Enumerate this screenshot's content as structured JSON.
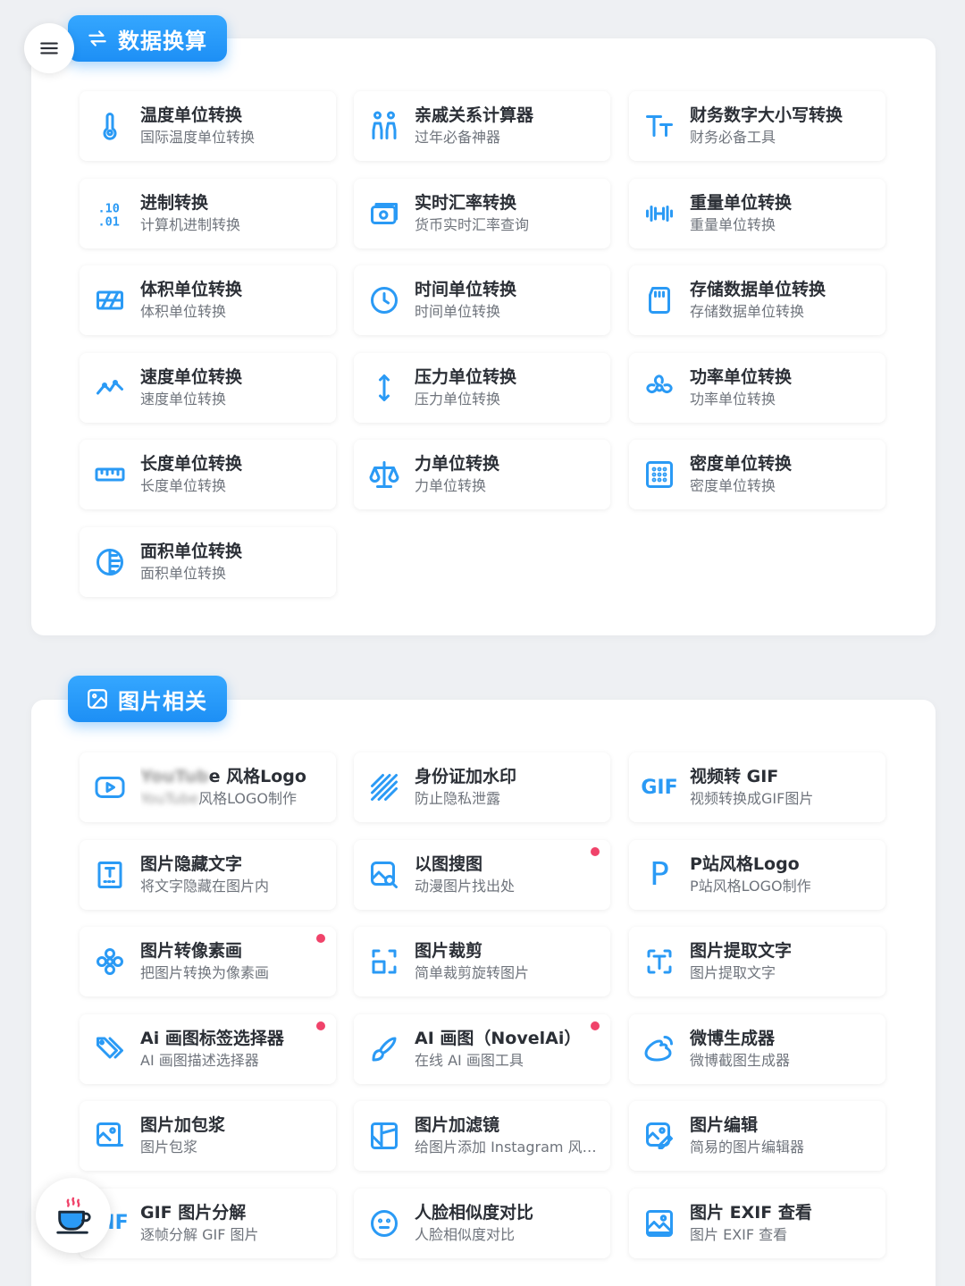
{
  "menu_button": {
    "icon": "menu-icon"
  },
  "coffee_button": {
    "icon": "coffee-cup-icon"
  },
  "sections": [
    {
      "title": "数据换算",
      "icon": "swap-arrows-icon",
      "items": [
        {
          "title": "温度单位转换",
          "subtitle": "国际温度单位转换",
          "icon": "thermometer-icon"
        },
        {
          "title": "亲戚关系计算器",
          "subtitle": "过年必备神器",
          "icon": "family-icon"
        },
        {
          "title": "财务数字大小写转换",
          "subtitle": "财务必备工具",
          "icon": "text-size-icon"
        },
        {
          "title": "进制转换",
          "subtitle": "计算机进制转换",
          "icon": "binary-icon"
        },
        {
          "title": "实时汇率转换",
          "subtitle": "货币实时汇率查询",
          "icon": "currency-icon"
        },
        {
          "title": "重量单位转换",
          "subtitle": "重量单位转换",
          "icon": "dumbbell-icon"
        },
        {
          "title": "体积单位转换",
          "subtitle": "体积单位转换",
          "icon": "volume-icon"
        },
        {
          "title": "时间单位转换",
          "subtitle": "时间单位转换",
          "icon": "clock-icon"
        },
        {
          "title": "存储数据单位转换",
          "subtitle": "存储数据单位转换",
          "icon": "sd-card-icon"
        },
        {
          "title": "速度单位转换",
          "subtitle": "速度单位转换",
          "icon": "line-chart-icon"
        },
        {
          "title": "压力单位转换",
          "subtitle": "压力单位转换",
          "icon": "up-down-arrow-icon"
        },
        {
          "title": "功率单位转换",
          "subtitle": "功率单位转换",
          "icon": "fan-icon"
        },
        {
          "title": "长度单位转换",
          "subtitle": "长度单位转换",
          "icon": "ruler-icon"
        },
        {
          "title": "力单位转换",
          "subtitle": "力单位转换",
          "icon": "scale-icon"
        },
        {
          "title": "密度单位转换",
          "subtitle": "密度单位转换",
          "icon": "grid-dots-icon"
        },
        {
          "title": "面积单位转换",
          "subtitle": "面积单位转换",
          "icon": "area-circle-icon"
        }
      ]
    },
    {
      "title": "图片相关",
      "icon": "image-icon",
      "items": [
        {
          "title_blur": "YouTub",
          "title": "e 风格Logo",
          "subtitle_blur": "YouTube",
          "subtitle": "风格LOGO制作",
          "icon": "play-icon"
        },
        {
          "title": "身份证加水印",
          "subtitle": "防止隐私泄露",
          "icon": "stripes-icon"
        },
        {
          "title": "视频转 GIF",
          "subtitle": "视频转换成GIF图片",
          "icon": "gif-text-icon",
          "icon_text": "GIF"
        },
        {
          "title": "图片隐藏文字",
          "subtitle": "将文字隐藏在图片内",
          "icon": "hidden-text-icon"
        },
        {
          "title": "以图搜图",
          "subtitle": "动漫图片找出处",
          "icon": "image-search-icon",
          "badge": true
        },
        {
          "title": "P站风格Logo",
          "subtitle": "P站风格LOGO制作",
          "icon": "letter-p-icon",
          "icon_text": "P"
        },
        {
          "title": "图片转像素画",
          "subtitle": "把图片转换为像素画",
          "icon": "flower-icon",
          "badge": true
        },
        {
          "title": "图片裁剪",
          "subtitle": "简单裁剪旋转图片",
          "icon": "crop-icon"
        },
        {
          "title": "图片提取文字",
          "subtitle": "图片提取文字",
          "icon": "text-scan-icon"
        },
        {
          "title": "Ai 画图标签选择器",
          "subtitle": "AI 画图描述选择器",
          "icon": "tags-icon",
          "badge": true
        },
        {
          "title": "AI 画图（NovelAi）",
          "subtitle": "在线 AI 画图工具",
          "icon": "brush-icon",
          "badge": true
        },
        {
          "title": "微博生成器",
          "subtitle": "微博截图生成器",
          "icon": "weibo-icon"
        },
        {
          "title": "图片加包浆",
          "subtitle": "图片包浆",
          "icon": "image-minus-icon"
        },
        {
          "title": "图片加滤镜",
          "subtitle": "给图片添加 Instagram 风格滤镜",
          "icon": "layout-icon"
        },
        {
          "title": "图片编辑",
          "subtitle": "简易的图片编辑器",
          "icon": "image-edit-icon"
        },
        {
          "title": "GIF 图片分解",
          "subtitle": "逐帧分解 GIF 图片",
          "icon": "gif-text-icon",
          "icon_text": "GIF"
        },
        {
          "title": "人脸相似度对比",
          "subtitle": "人脸相似度对比",
          "icon": "face-icon"
        },
        {
          "title": "图片 EXIF 查看",
          "subtitle": "图片 EXIF 查看",
          "icon": "image-frame-icon"
        }
      ]
    }
  ],
  "colors": {
    "accent": "#2a9af5",
    "badge": "#f0436a",
    "background": "#eef0f3"
  }
}
